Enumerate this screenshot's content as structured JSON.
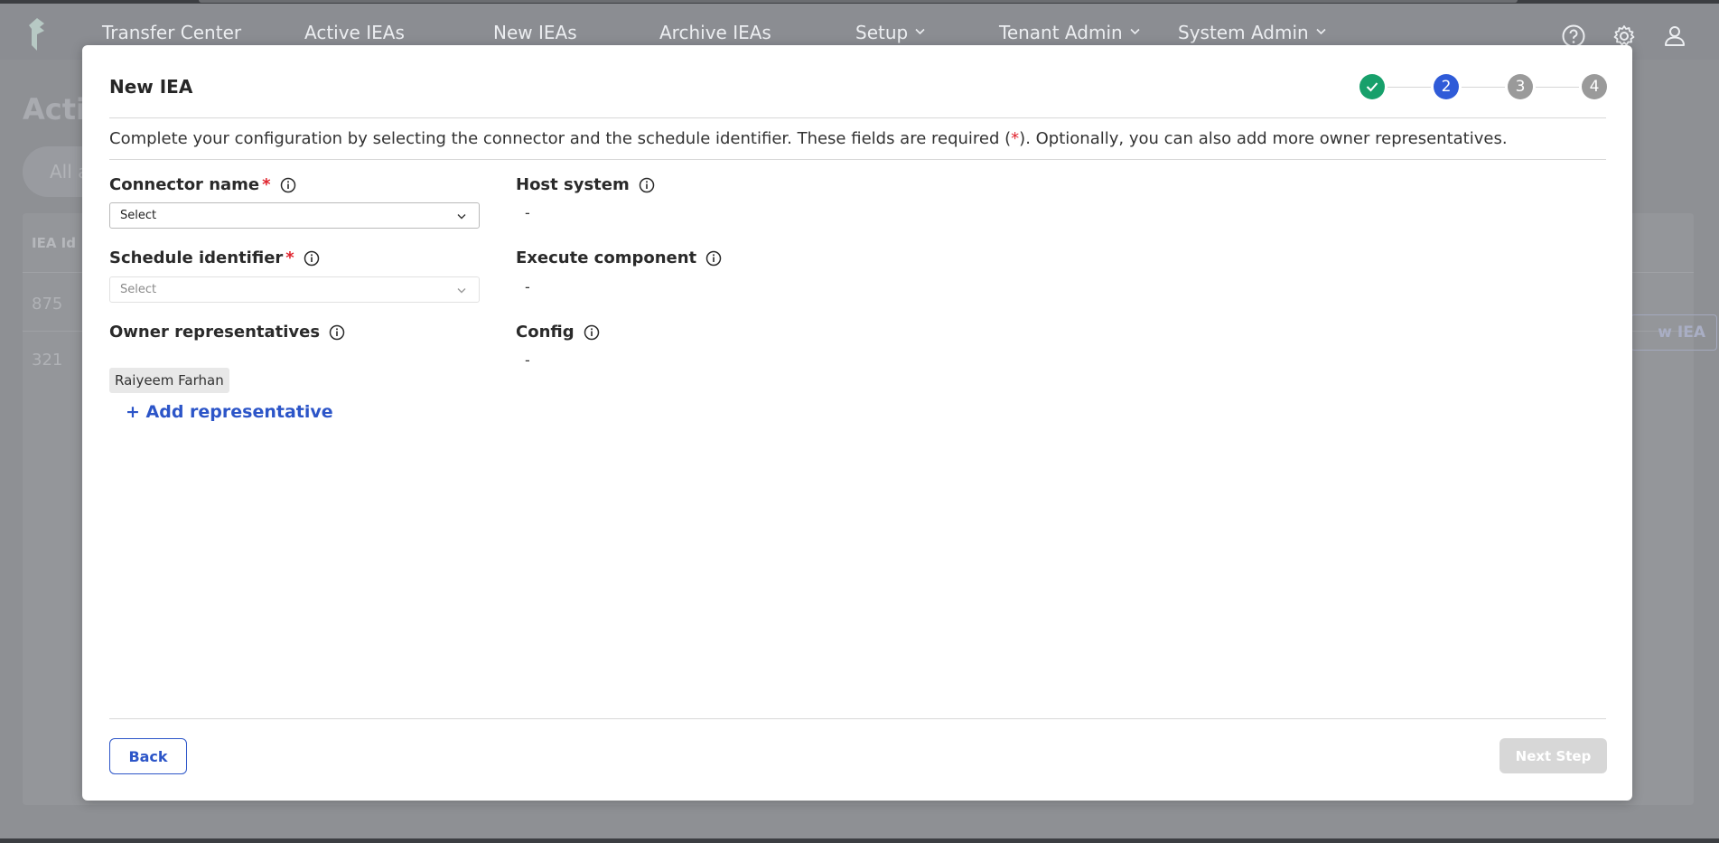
{
  "nav": {
    "items": [
      {
        "label": "Transfer Center",
        "has_menu": false
      },
      {
        "label": "Active IEAs",
        "has_menu": false
      },
      {
        "label": "New IEAs",
        "has_menu": false
      },
      {
        "label": "Archive IEAs",
        "has_menu": false
      },
      {
        "label": "Setup",
        "has_menu": true
      },
      {
        "label": "Tenant Admin",
        "has_menu": true
      },
      {
        "label": "System Admin",
        "has_menu": true
      }
    ],
    "icons": [
      "help-icon",
      "settings-icon",
      "user-icon"
    ]
  },
  "background": {
    "title": "Acti",
    "filter_text": "All a",
    "column_header": "IEA Id",
    "rows": [
      "875",
      "321"
    ],
    "new_button": "w IEA"
  },
  "modal": {
    "title": "New IEA",
    "steps": [
      {
        "label": "✓",
        "state": "done"
      },
      {
        "label": "2",
        "state": "active"
      },
      {
        "label": "3",
        "state": "todo"
      },
      {
        "label": "4",
        "state": "todo"
      }
    ],
    "description_before": "Complete your configuration by selecting the connector and the schedule identifier. These fields are required (",
    "description_star": "*",
    "description_after": "). Optionally, you can also add more owner representatives.",
    "fields": {
      "connector_name": {
        "label": "Connector name",
        "required": "*",
        "value": "Select"
      },
      "schedule_identifier": {
        "label": "Schedule identifier",
        "required": "*",
        "value": "Select"
      },
      "owner_representatives": {
        "label": "Owner representatives",
        "chip": "Raiyeem Farhan",
        "add_label": "+ Add representative"
      },
      "host_system": {
        "label": "Host system",
        "value": "-"
      },
      "execute_component": {
        "label": "Execute component",
        "value": "-"
      },
      "config": {
        "label": "Config",
        "value": "-"
      }
    },
    "back_label": "Back",
    "next_label": "Next Step"
  },
  "colors": {
    "accent": "#2c55c8",
    "step_done": "#17a06b",
    "step_active": "#2f5bd8",
    "step_todo": "#9a9a9a",
    "required": "#e0242e"
  }
}
